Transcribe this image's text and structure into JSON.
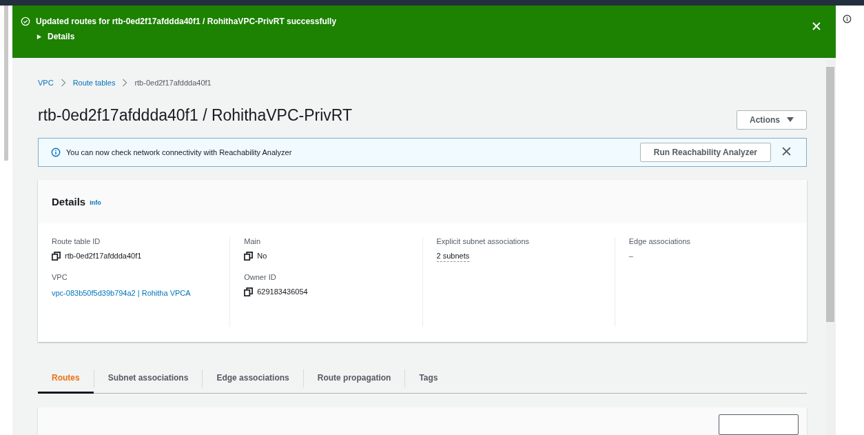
{
  "flash": {
    "message": "Updated routes for rtb-0ed2f17afddda40f1 / RohithaVPC-PrivRT successfully",
    "details_label": "Details",
    "expanded": false
  },
  "breadcrumbs": [
    {
      "label": "VPC",
      "link": true
    },
    {
      "label": "Route tables",
      "link": true
    },
    {
      "label": "rtb-0ed2f17afddda40f1",
      "link": false
    }
  ],
  "page_title": "rtb-0ed2f17afddda40f1 / RohithaVPC-PrivRT",
  "actions_button": "Actions",
  "alert": {
    "message": "You can now check network connectivity with Reachability Analyzer",
    "button": "Run Reachability Analyzer"
  },
  "details": {
    "title": "Details",
    "info": "Info",
    "columns": [
      [
        {
          "label": "Route table ID",
          "value": "rtb-0ed2f17afddda40f1",
          "kind": "copy"
        },
        {
          "label": "VPC",
          "value": "vpc-083b50f5d39b794a2 | Rohitha VPCA",
          "kind": "link"
        }
      ],
      [
        {
          "label": "Main",
          "value": "No",
          "kind": "copy"
        },
        {
          "label": "Owner ID",
          "value": "629183436054",
          "kind": "copy"
        }
      ],
      [
        {
          "label": "Explicit subnet associations",
          "value": "2 subnets",
          "kind": "popover"
        }
      ],
      [
        {
          "label": "Edge associations",
          "value": "–",
          "kind": "plain"
        }
      ]
    ]
  },
  "tabs": [
    {
      "label": "Routes",
      "selected": true
    },
    {
      "label": "Subnet associations",
      "selected": false
    },
    {
      "label": "Edge associations",
      "selected": false
    },
    {
      "label": "Route propagation",
      "selected": false
    },
    {
      "label": "Tags",
      "selected": false
    }
  ]
}
